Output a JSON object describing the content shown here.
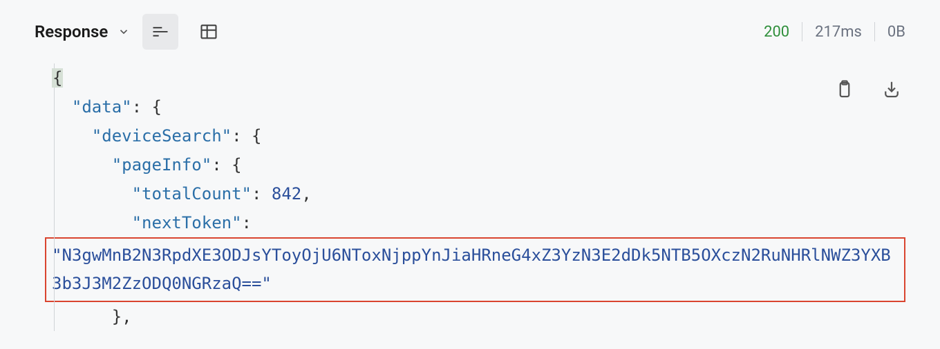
{
  "header": {
    "title": "Response",
    "status_code": "200",
    "time": "217ms",
    "size": "0B"
  },
  "response": {
    "keys": {
      "data": "data",
      "deviceSearch": "deviceSearch",
      "pageInfo": "pageInfo",
      "totalCount": "totalCount",
      "nextToken": "nextToken"
    },
    "values": {
      "totalCount": "842",
      "nextToken": "\"N3gwMnB2N3RpdXE3ODJsYToyOjU6NToxNjppYnJiaHRneG4xZ3YzN3E2dDk5NTB5OXczN2RuNHRlNWZ3YXB3b3J3M2ZzODQ0NGRzaQ==\""
    }
  },
  "icons": {
    "format": "format-icon",
    "table": "table-icon",
    "copy": "clipboard-icon",
    "download": "download-icon"
  }
}
